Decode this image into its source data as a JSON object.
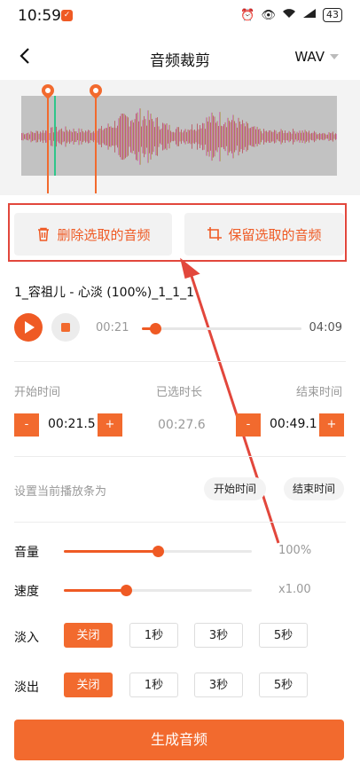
{
  "status_bar": {
    "time": "10:59",
    "battery": "43"
  },
  "header": {
    "title": "音频裁剪",
    "format": "WAV"
  },
  "actions": {
    "delete_label": "删除选取的音频",
    "keep_label": "保留选取的音频"
  },
  "file": {
    "name": "1_容祖儿 - 心淡 (100%)_1_1_1",
    "current_time": "00:21",
    "total_time": "04:09",
    "progress": 0.084
  },
  "range": {
    "start_label": "开始时间",
    "selected_label": "已选时长",
    "end_label": "结束时间",
    "start_value": "00:21.5",
    "selected_value": "00:27.6",
    "end_value": "00:49.1",
    "minus": "-",
    "plus": "+"
  },
  "playbar": {
    "label": "设置当前播放条为",
    "start_btn": "开始时间",
    "end_btn": "结束时间"
  },
  "volume": {
    "label": "音量",
    "value_text": "100%",
    "level": 0.5
  },
  "speed": {
    "label": "速度",
    "value_text": "x1.00",
    "level": 0.33
  },
  "fade_in": {
    "label": "淡入",
    "options": [
      "关闭",
      "1秒",
      "3秒",
      "5秒"
    ],
    "selected": 0
  },
  "fade_out": {
    "label": "淡出",
    "options": [
      "关闭",
      "1秒",
      "3秒",
      "5秒"
    ],
    "selected": 0
  },
  "generate": {
    "label": "生成音频"
  },
  "colors": {
    "accent": "#f26a2e",
    "highlight": "#e2473c",
    "green": "#2fc58a"
  }
}
